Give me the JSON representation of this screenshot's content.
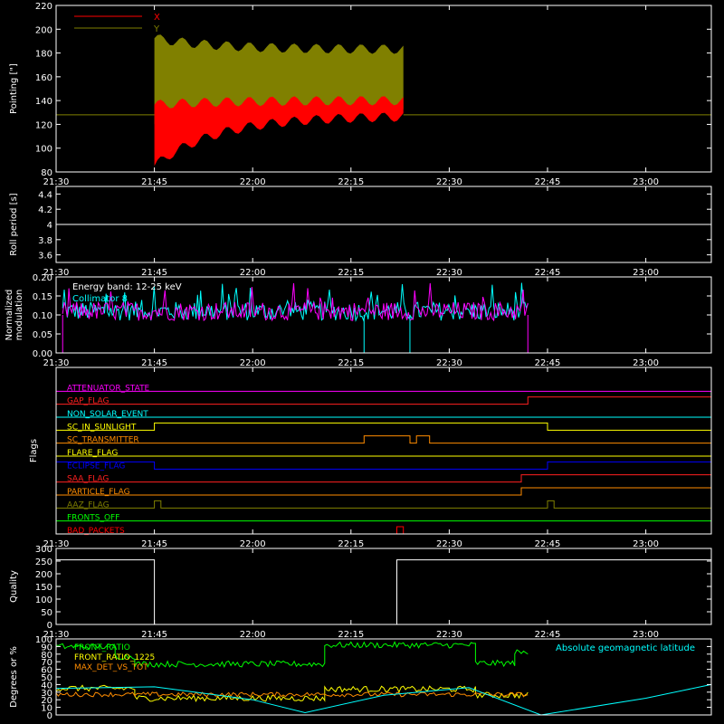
{
  "colors": {
    "background": "#000000",
    "axis": "#ffffff",
    "x_pointing": "#ff0000",
    "y_pointing": "#808000",
    "roll": "#ffffff",
    "mod_collimator": "#00ffff",
    "mod_magenta": "#ff00ff",
    "front_ratio": "#00ff00",
    "front_ratio_1225": "#ffff00",
    "max_det_vs_tot": "#ff8c00",
    "geomag": "#00ffff"
  },
  "chart_data": [
    {
      "type": "area",
      "id": "pointing",
      "ylabel": "Pointing [\"]",
      "ylim": [
        80,
        220
      ],
      "yticks": [
        80,
        100,
        120,
        140,
        160,
        180,
        200,
        220
      ],
      "xlim": [
        "21:30",
        "23:10"
      ],
      "xticks": [
        "21:30",
        "21:45",
        "22:00",
        "22:15",
        "22:30",
        "22:45",
        "23:00"
      ],
      "grid": false,
      "legend": "top-left",
      "baseline": 128,
      "active_range": [
        "21:45",
        "22:23"
      ],
      "series": [
        {
          "name": "X",
          "color": "#ff0000",
          "lower_start": 85,
          "lower_end": 127,
          "upper_start": 130,
          "upper_end": 140
        },
        {
          "name": "Y",
          "color": "#808000",
          "lower_start": 120,
          "lower_end": 130,
          "upper_start": 210,
          "upper_end": 183
        }
      ]
    },
    {
      "type": "line",
      "id": "roll",
      "ylabel": "Roll period [s]",
      "ylim": [
        3.5,
        4.5
      ],
      "yticks": [
        3.6,
        3.8,
        4.0,
        4.2,
        4.4
      ],
      "xticks": [
        "21:30",
        "21:45",
        "22:00",
        "22:15",
        "22:30",
        "22:45",
        "23:00"
      ],
      "value": 4.0
    },
    {
      "type": "line",
      "id": "modulation",
      "ylabel": "Normalized modulation",
      "ylim": [
        0.0,
        0.2
      ],
      "yticks": [
        "0.00",
        "0.05",
        "0.10",
        "0.15",
        "0.20"
      ],
      "xticks": [
        "21:30",
        "21:45",
        "22:00",
        "22:15",
        "22:30",
        "22:45",
        "23:00"
      ],
      "legend_lines": [
        "Energy band: 12-25 keV",
        "Collimator 8"
      ],
      "active_range": [
        "21:30",
        "22:42"
      ],
      "mean": 0.11
    },
    {
      "type": "line",
      "id": "flags",
      "ylabel": "Flags",
      "xticks": [
        "21:30",
        "21:45",
        "22:00",
        "22:15",
        "22:30",
        "22:45",
        "23:00"
      ],
      "flags": [
        {
          "name": "ATTENUATOR_STATE",
          "color": "#ff00ff",
          "segments": [
            [
              "21:30",
              "23:10",
              0
            ]
          ]
        },
        {
          "name": "GAP_FLAG",
          "color": "#ff2020",
          "segments": [
            [
              "21:30",
              "22:42",
              0
            ],
            [
              "22:42",
              "23:10",
              1
            ]
          ]
        },
        {
          "name": "NON_SOLAR_EVENT",
          "color": "#00ffff",
          "segments": [
            [
              "21:30",
              "23:10",
              0
            ]
          ]
        },
        {
          "name": "SC_IN_SUNLIGHT",
          "color": "#ffff00",
          "segments": [
            [
              "21:30",
              "21:45",
              0
            ],
            [
              "21:45",
              "22:45",
              1
            ],
            [
              "22:45",
              "23:10",
              0
            ]
          ]
        },
        {
          "name": "SC_TRANSMITTER",
          "color": "#ff8c00",
          "segments": [
            [
              "21:30",
              "22:17",
              0
            ],
            [
              "22:17",
              "22:24",
              1
            ],
            [
              "22:24",
              "22:25",
              0
            ],
            [
              "22:25",
              "22:27",
              1
            ],
            [
              "22:27",
              "23:10",
              0
            ]
          ]
        },
        {
          "name": "FLARE_FLAG",
          "color": "#ffff00",
          "segments": [
            [
              "21:30",
              "23:10",
              0
            ]
          ]
        },
        {
          "name": "ECLIPSE_FLAG",
          "color": "#0000ff",
          "segments": [
            [
              "21:30",
              "21:45",
              1
            ],
            [
              "21:45",
              "22:45",
              0
            ],
            [
              "22:45",
              "23:10",
              1
            ]
          ]
        },
        {
          "name": "SAA_FLAG",
          "color": "#ff2020",
          "segments": [
            [
              "21:30",
              "22:41",
              0
            ],
            [
              "22:41",
              "23:10",
              1
            ]
          ]
        },
        {
          "name": "PARTICLE_FLAG",
          "color": "#ff8c00",
          "segments": [
            [
              "21:30",
              "22:41",
              0
            ],
            [
              "22:41",
              "23:10",
              1
            ]
          ]
        },
        {
          "name": "AAZ_FLAG",
          "color": "#808000",
          "segments": [
            [
              "21:30",
              "21:45",
              0
            ],
            [
              "21:45",
              "21:46",
              1
            ],
            [
              "21:46",
              "22:45",
              0
            ],
            [
              "22:45",
              "22:46",
              1
            ],
            [
              "22:46",
              "23:10",
              0
            ]
          ]
        },
        {
          "name": "FRONTS_OFF",
          "color": "#00ff00",
          "segments": [
            [
              "21:30",
              "23:10",
              0
            ]
          ]
        },
        {
          "name": "BAD_PACKETS",
          "color": "#ff0000",
          "segments": [
            [
              "21:30",
              "22:22",
              0
            ],
            [
              "22:22",
              "22:23",
              1
            ],
            [
              "22:23",
              "23:10",
              0
            ]
          ]
        }
      ]
    },
    {
      "type": "line",
      "id": "quality",
      "ylabel": "Quality",
      "ylim": [
        0,
        300
      ],
      "yticks": [
        0,
        50,
        100,
        150,
        200,
        250,
        300
      ],
      "xticks": [
        "21:30",
        "21:45",
        "22:00",
        "22:15",
        "22:30",
        "22:45",
        "23:00"
      ],
      "steps": [
        [
          "21:30",
          "21:45",
          255
        ],
        [
          "21:45",
          "22:22",
          0
        ],
        [
          "22:22",
          "23:10",
          255
        ]
      ]
    },
    {
      "type": "line",
      "id": "ratios",
      "ylabel": "Degrees or %",
      "ylim": [
        0,
        100
      ],
      "yticks": [
        0,
        10,
        20,
        30,
        40,
        50,
        60,
        70,
        80,
        90,
        100
      ],
      "series": [
        {
          "name": "FRONT_RATIO",
          "color": "#00ff00",
          "segments": [
            [
              "21:30",
              "21:39",
              90
            ],
            [
              "21:39",
              "21:42",
              77
            ],
            [
              "21:42",
              "22:11",
              67
            ],
            [
              "22:11",
              "22:34",
              92
            ],
            [
              "22:34",
              "22:40",
              68
            ],
            [
              "22:40",
              "22:42",
              82
            ]
          ]
        },
        {
          "name": "FRONT_RATIO_1225",
          "color": "#ffff00",
          "segments": [
            [
              "21:30",
              "21:42",
              35
            ],
            [
              "21:42",
              "22:11",
              22
            ],
            [
              "22:11",
              "22:34",
              34
            ],
            [
              "22:34",
              "22:42",
              26
            ]
          ]
        },
        {
          "name": "MAX_DET_VS_TOT",
          "color": "#ff8c00",
          "segments": [
            [
              "21:30",
              "22:42",
              27
            ]
          ]
        },
        {
          "name": "Absolute geomagnetic latitude",
          "color": "#00ffff",
          "points": [
            [
              "21:30",
              35
            ],
            [
              "21:45",
              37
            ],
            [
              "22:00",
              20
            ],
            [
              "22:08",
              3
            ],
            [
              "22:20",
              26
            ],
            [
              "22:33",
              36
            ],
            [
              "22:44",
              0
            ],
            [
              "23:00",
              22
            ],
            [
              "23:10",
              40
            ]
          ]
        }
      ]
    }
  ]
}
